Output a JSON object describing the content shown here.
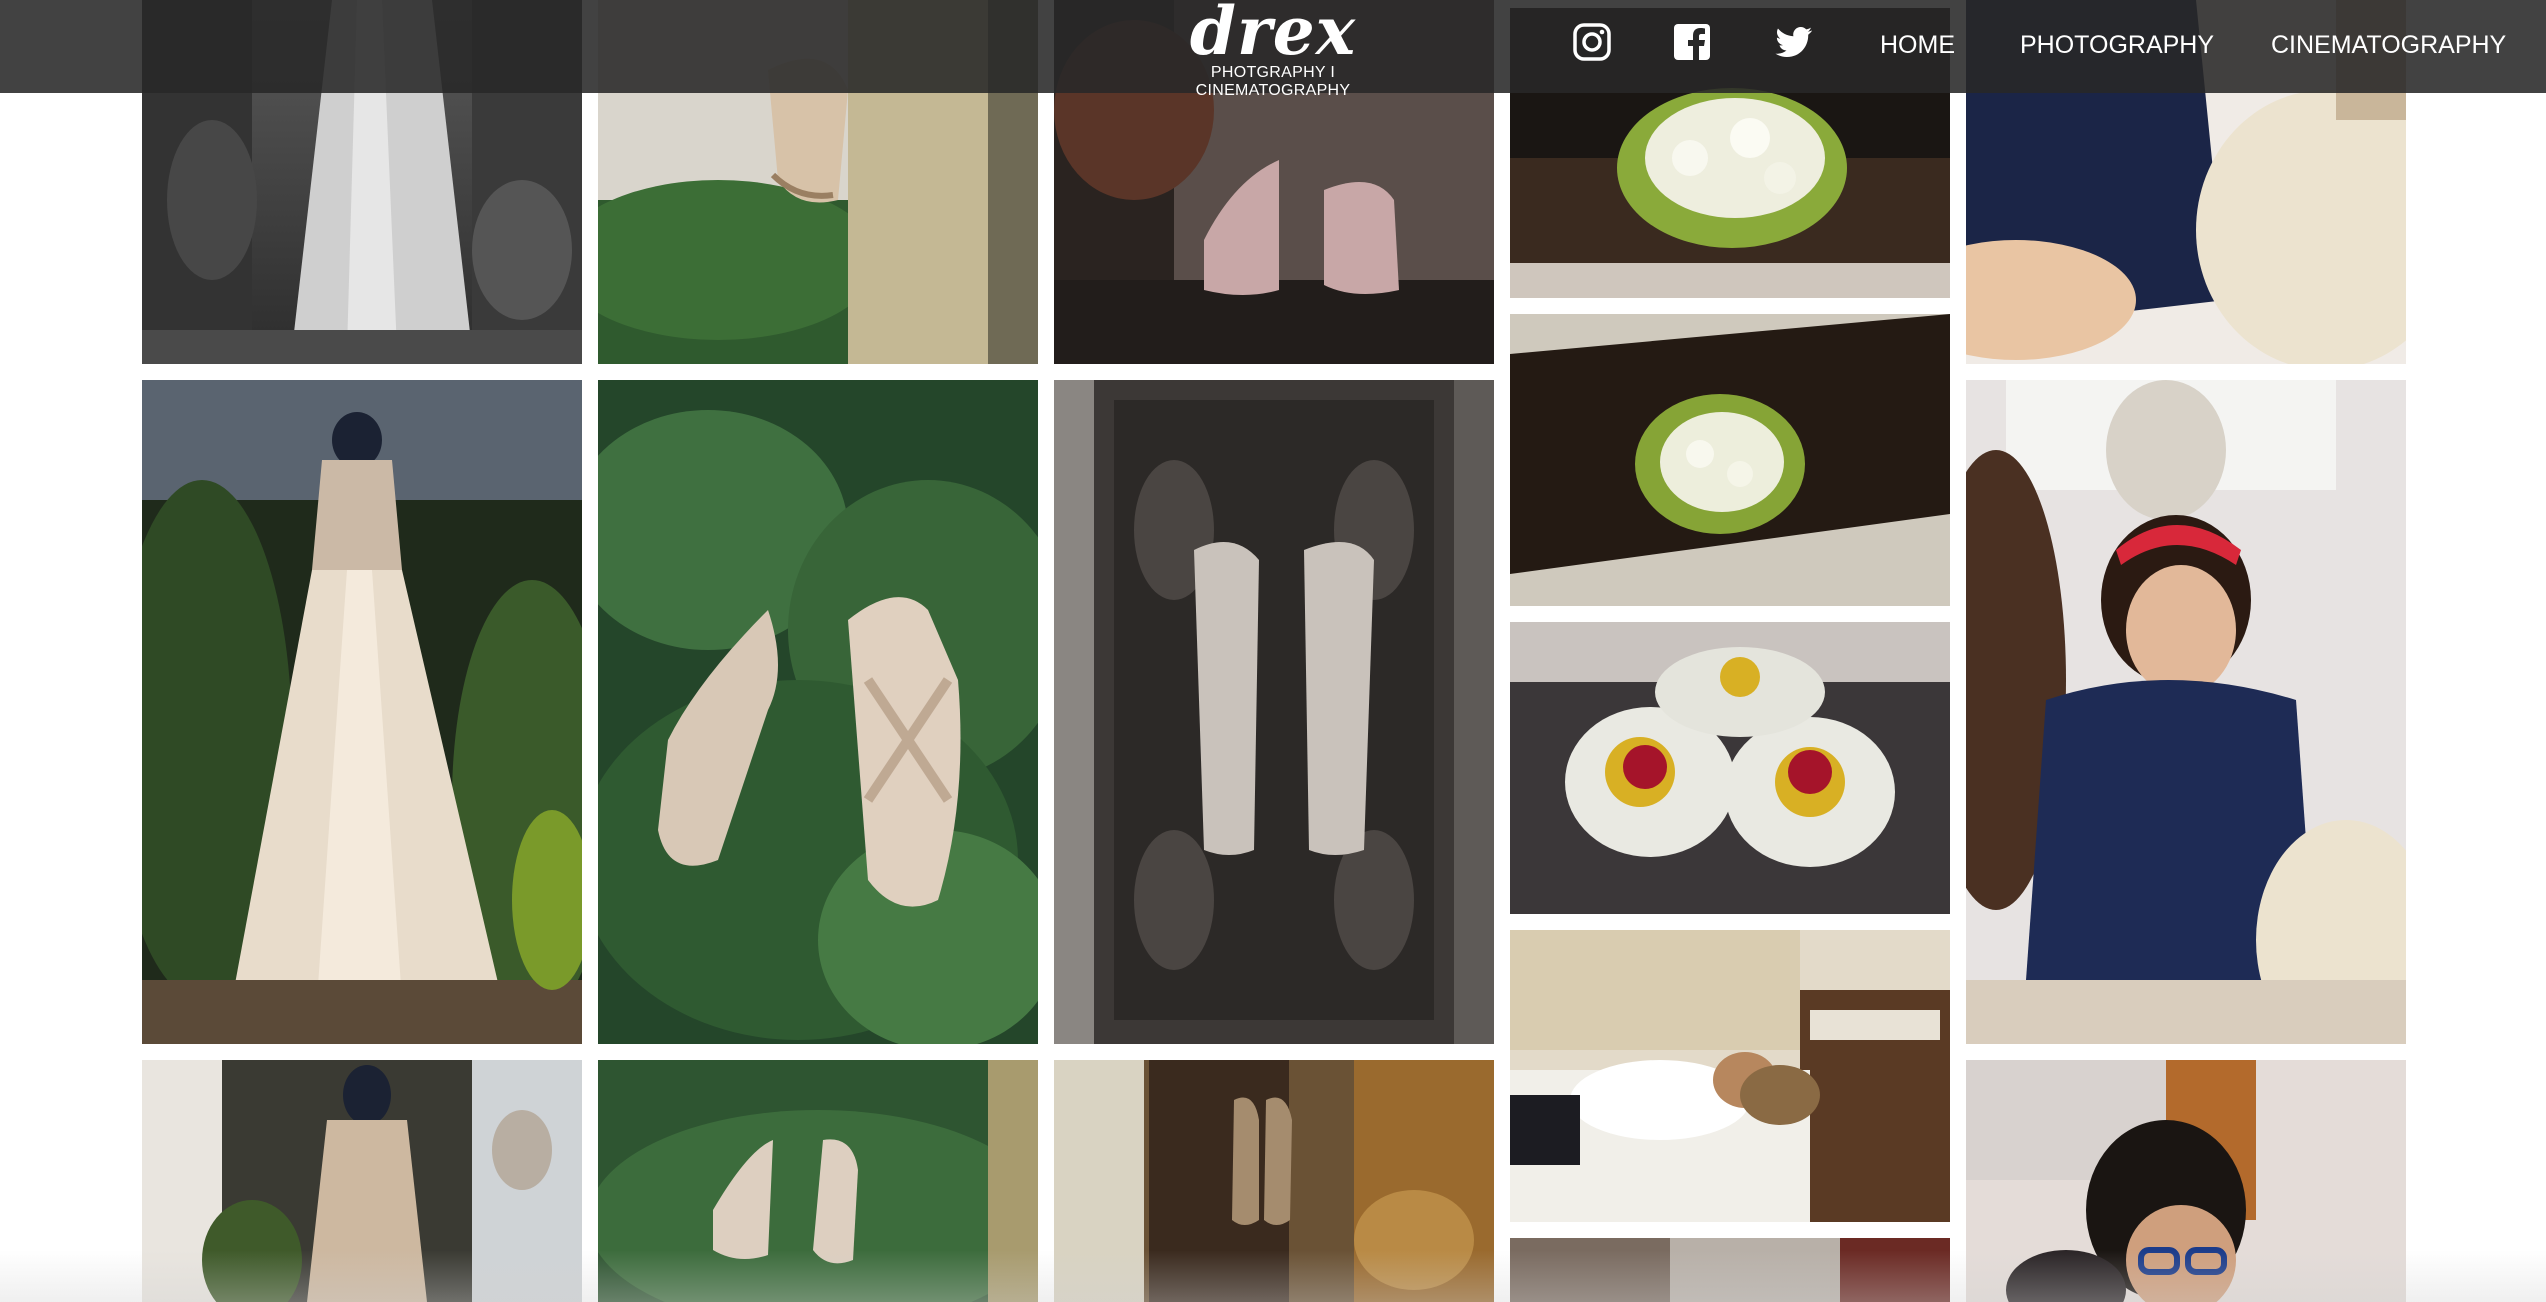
{
  "header": {
    "logo": {
      "word": "drex",
      "tagline": "PHOTGRAPHY I CINEMATOGRAPHY"
    },
    "social": [
      {
        "name": "instagram-icon"
      },
      {
        "name": "facebook-icon"
      },
      {
        "name": "twitter-icon"
      }
    ],
    "nav": [
      {
        "label": "HOME"
      },
      {
        "label": "PHOTOGRAPHY"
      },
      {
        "label": "CINEMATOGRAPHY"
      }
    ]
  },
  "colors": {
    "header_bg": "#282828",
    "nav_text": "#ffffff",
    "page_bg": "#ffffff"
  },
  "gallery": {
    "photos": [
      {
        "subject": "bridal-gown-garden-grayscale"
      },
      {
        "subject": "heel-on-pillar-with-ferns"
      },
      {
        "subject": "pink-sandals-on-shelf"
      },
      {
        "subject": "white-bouquet"
      },
      {
        "subject": "woman-in-navy-shirt"
      },
      {
        "subject": "white-bouquet-on-wood"
      },
      {
        "subject": "red-yellow-flower-corsages"
      },
      {
        "subject": "bridal-gown-on-mannequin"
      },
      {
        "subject": "strappy-heels-on-ferns"
      },
      {
        "subject": "sandals-on-carved-wood"
      },
      {
        "subject": "bride-getting-ready-red-headband"
      },
      {
        "subject": "woman-resting-on-bed"
      },
      {
        "subject": "bridal-gown-mannequin-detail"
      },
      {
        "subject": "heels-on-ferns-wide"
      },
      {
        "subject": "sandals-on-carved-panel-warm"
      },
      {
        "subject": "hotel-room-detail"
      },
      {
        "subject": "woman-with-glasses"
      }
    ]
  }
}
